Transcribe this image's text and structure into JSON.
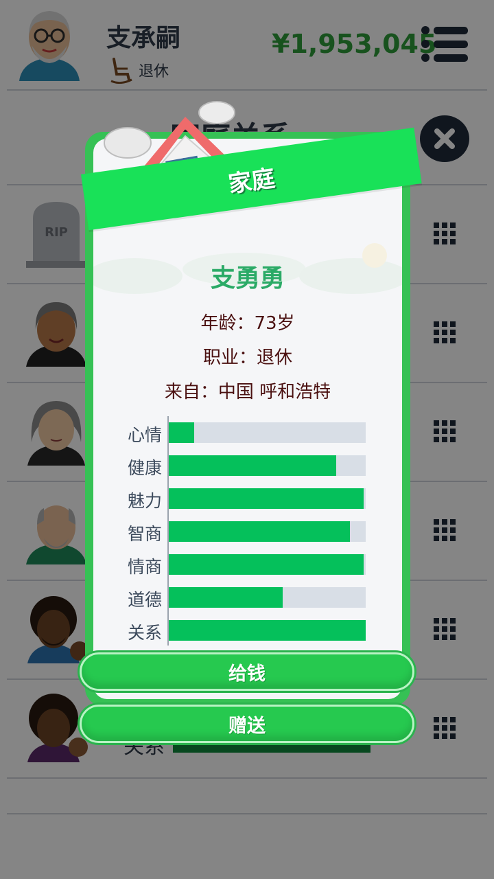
{
  "header": {
    "player_name": "支承嗣",
    "player_job": "退休",
    "money": "¥1,953,045"
  },
  "page": {
    "title": "家庭关系",
    "bg_row_label": "关系"
  },
  "modal": {
    "ribbon_label": "家庭",
    "person_name": "支勇勇",
    "age": "年龄：73岁",
    "job": "职业：退休",
    "origin": "来自：中国 呼和浩特",
    "stats": [
      {
        "label": "心情",
        "value": 0.13
      },
      {
        "label": "健康",
        "value": 0.85
      },
      {
        "label": "魅力",
        "value": 0.99
      },
      {
        "label": "智商",
        "value": 0.92
      },
      {
        "label": "情商",
        "value": 0.99
      },
      {
        "label": "道德",
        "value": 0.58
      },
      {
        "label": "关系",
        "value": 1.0
      }
    ],
    "give_money_label": "给钱",
    "gift_label": "赠送"
  },
  "colors": {
    "accent_green": "#19e158",
    "bar_green": "#05c05b",
    "money_green": "#2f9e3a"
  }
}
